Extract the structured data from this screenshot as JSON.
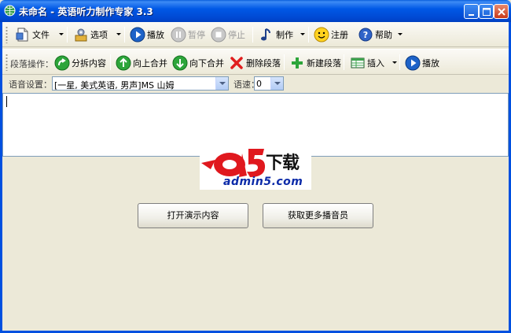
{
  "window": {
    "title": "未命名 - 英语听力制作专家 3.3"
  },
  "toolbar_main": {
    "file": "文件",
    "options": "选项",
    "play": "播放",
    "pause": "暂停",
    "stop": "停止",
    "make": "制作",
    "register": "注册",
    "help": "帮助"
  },
  "toolbar_paragraph": {
    "label": "段落操作：",
    "split": "分拆内容",
    "merge_up": "向上合并",
    "merge_down": "向下合并",
    "delete": "删除段落",
    "new": "新建段落",
    "insert": "插入",
    "play": "播放"
  },
  "voice_settings": {
    "label": "语音设置：",
    "voice_value": "[一星, 美式英语, 男声]MS 山姆",
    "speed_label": "语速：",
    "speed_value": "0"
  },
  "watermark": {
    "mark": "a5",
    "download": "下载",
    "site": "admin5.com"
  },
  "actions": {
    "open_demo": "打开演示内容",
    "get_more_voices": "获取更多播音员"
  },
  "colors": {
    "titlebar": "#0058e6",
    "logo_red": "#e0181e",
    "logo_blue": "#0b2aa8"
  }
}
